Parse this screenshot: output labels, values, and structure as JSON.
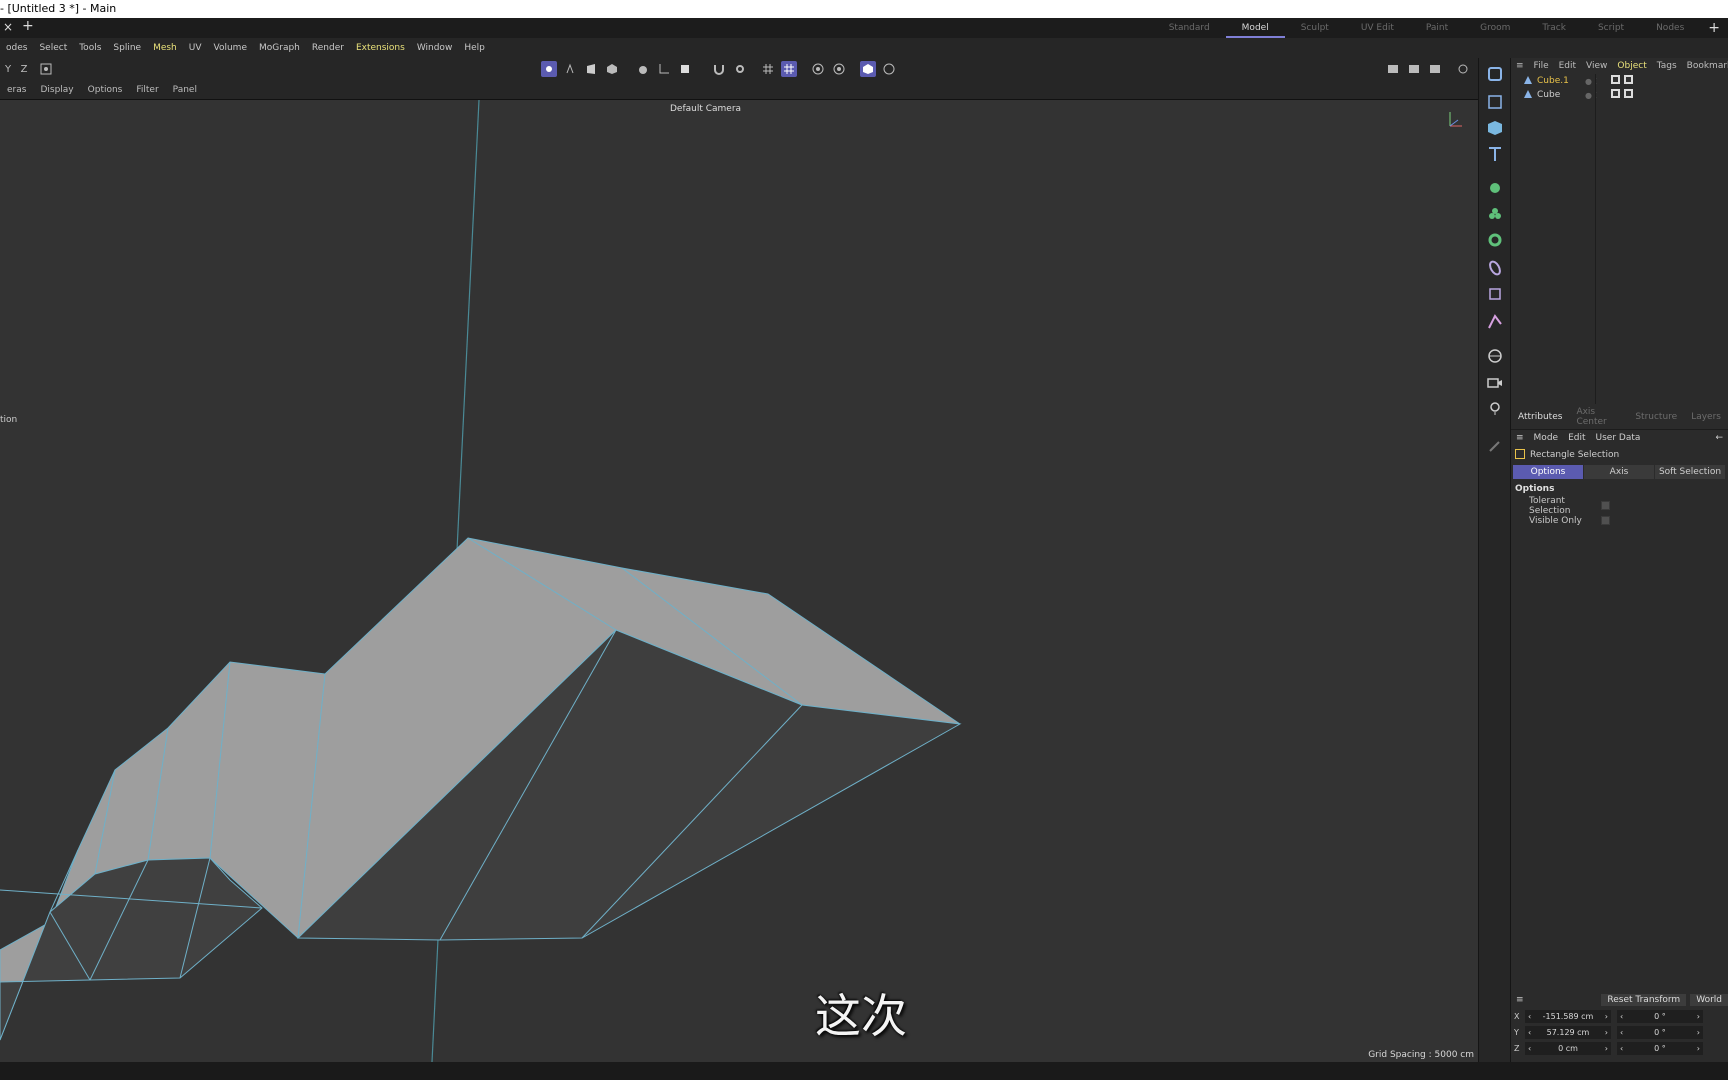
{
  "window": {
    "title": "- [Untitled 3 *] - Main"
  },
  "tabbar": {
    "close": "×",
    "add": "+"
  },
  "layouts": [
    "Standard",
    "Model",
    "Sculpt",
    "UV Edit",
    "Paint",
    "Groom",
    "Track",
    "Script",
    "Nodes"
  ],
  "layouts_active": "Model",
  "layouts_add": "+",
  "menubar": [
    "odes",
    "Select",
    "Tools",
    "Spline",
    "Mesh",
    "UV",
    "Volume",
    "MoGraph",
    "Render",
    "Extensions",
    "Window",
    "Help"
  ],
  "toolbar": {
    "y": "Y",
    "z": "Z"
  },
  "viewport_menu": [
    "eras",
    "Display",
    "Options",
    "Filter",
    "Panel"
  ],
  "viewport": {
    "camera": "Default Camera",
    "grid_spacing": "Grid Spacing : 5000 cm",
    "left_text": "tion"
  },
  "subtitle": "这次",
  "object_manager": {
    "menu": [
      "File",
      "Edit",
      "View",
      "Object",
      "Tags",
      "Bookmarks"
    ],
    "active_menu": "Object",
    "objects": [
      {
        "name": "Cube.1",
        "selected": true
      },
      {
        "name": "Cube",
        "selected": false
      }
    ]
  },
  "attributes": {
    "tabs": [
      "Attributes",
      "Axis Center",
      "Structure",
      "Layers"
    ],
    "active_tab": "Attributes",
    "menu": [
      "Mode",
      "Edit",
      "User Data"
    ],
    "tool_name": "Rectangle Selection",
    "subtabs": [
      "Options",
      "Axis",
      "Soft Selection"
    ],
    "active_subtab": "Options",
    "section": "Options",
    "options": [
      {
        "label": "Tolerant Selection",
        "checked": false
      },
      {
        "label": "Visible Only",
        "checked": false
      }
    ]
  },
  "coordinates": {
    "reset_label": "Reset Transform",
    "space_label": "World",
    "rows": [
      {
        "axis": "X",
        "pos": "-151.589 cm",
        "rot": "0 °"
      },
      {
        "axis": "Y",
        "pos": "57.129 cm",
        "rot": "0 °"
      },
      {
        "axis": "Z",
        "pos": "0 cm",
        "rot": "0 °"
      }
    ]
  },
  "colors": {
    "accent": "#5b5bb0",
    "highlight_text": "#e8e07a",
    "selected_object": "#e8c24a",
    "viewport_bg": "#333333",
    "edge": "#6fb0c8"
  }
}
